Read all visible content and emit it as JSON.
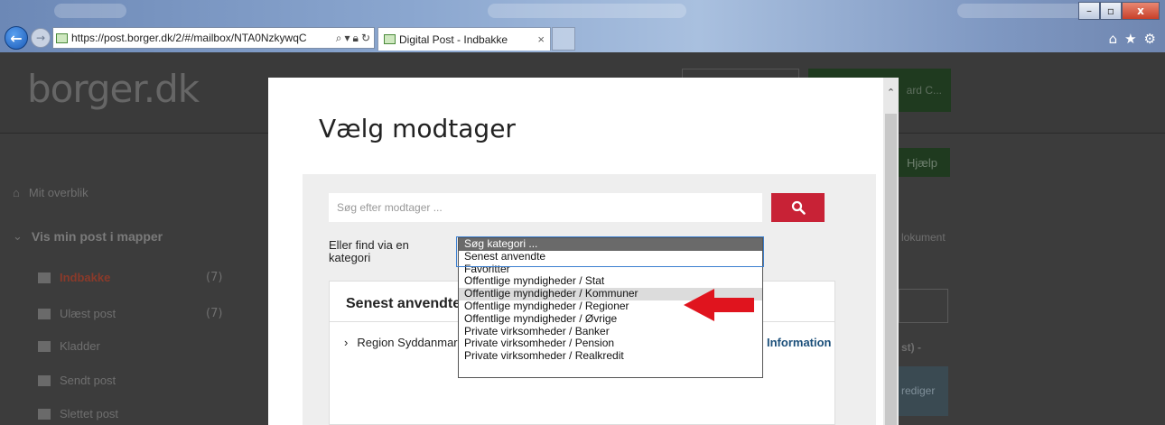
{
  "browser": {
    "url": "https://post.borger.dk/2/#/mailbox/NTA0NzkywqC",
    "url_host": "borger.dk",
    "tab_title": "Digital Post - Indbakke",
    "window_controls": [
      "–",
      "▫",
      "x"
    ]
  },
  "page": {
    "logo": "borger.dk",
    "header_button_text": "ard C...",
    "help_label": "Hjælp",
    "home_label": "Mit overblik",
    "folders_title": "Vis min post i mapper",
    "sidebar": [
      {
        "label": "Indbakke",
        "count": "(7)"
      },
      {
        "label": "Ulæst post",
        "count": "(7)"
      },
      {
        "label": "Kladder",
        "count": ""
      },
      {
        "label": "Sendt post",
        "count": ""
      },
      {
        "label": "Slettet post",
        "count": ""
      }
    ],
    "right_text_dokument": "lokument",
    "right_text_st": "st) -",
    "right_text_rediger": "rediger"
  },
  "modal": {
    "title": "Vælg modtager",
    "search_placeholder": "Søg efter modtager ...",
    "category_label": "Eller find via en kategori",
    "recent_heading": "Senest anvendte",
    "recent_item": "Region Syddanmark",
    "recent_link": "Information"
  },
  "dropdown": {
    "options": [
      "Søg kategori ...",
      "Senest anvendte",
      "Favoritter",
      "Offentlige myndigheder / Stat",
      "Offentlige myndigheder / Kommuner",
      "Offentlige myndigheder / Regioner",
      "Offentlige myndigheder / Øvrige",
      "Private virksomheder / Banker",
      "Private virksomheder / Pension",
      "Private virksomheder / Realkredit"
    ],
    "selected_index": 0,
    "hover_index": 4
  },
  "colors": {
    "accent_red": "#c82236",
    "arrow_red": "#e0141e",
    "link_blue": "#1b4f7a"
  }
}
